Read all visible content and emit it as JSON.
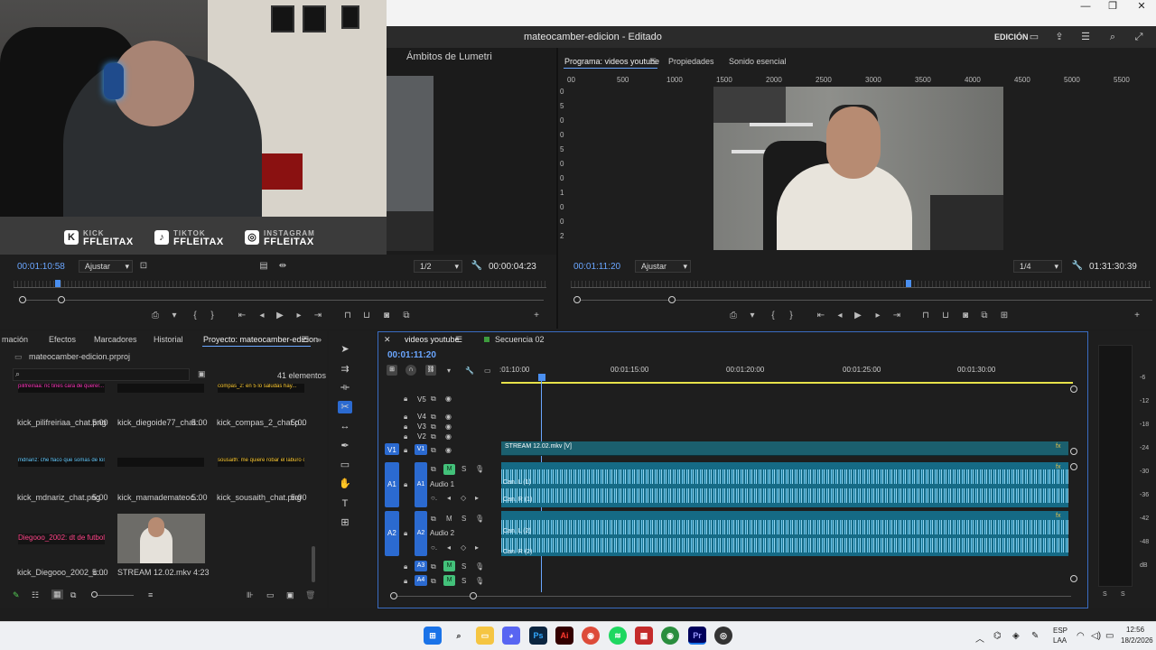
{
  "app": {
    "title": "mateocamber-edicion - Editado",
    "workspace": "EDICIÓN"
  },
  "webcam": {
    "socials": [
      {
        "icon": "kick-icon",
        "small": "KICK",
        "handle": "FFLEITAX",
        "glyph": "K"
      },
      {
        "icon": "tiktok-icon",
        "small": "TIKTOK",
        "handle": "FFLEITAX",
        "glyph": "♪"
      },
      {
        "icon": "instagram-icon",
        "small": "INSTAGRAM",
        "handle": "FFLEITAX",
        "glyph": "◎"
      }
    ]
  },
  "source_panel": {
    "tab": "Ámbitos de Lumetri"
  },
  "source_monitor": {
    "timecode": "00:01:10:58",
    "fit": "Ajustar",
    "resolution": "1/2",
    "duration": "00:00:04:23"
  },
  "program_monitor": {
    "tabs": [
      "Programa: videos youtube",
      "Propiedades",
      "Sonido esencial"
    ],
    "ruler": [
      "00",
      "500",
      "1000",
      "1500",
      "2000",
      "2500",
      "3000",
      "3500",
      "4000",
      "4500",
      "5000",
      "5500"
    ],
    "vruler": [
      "0",
      "5",
      "0",
      "0",
      "5",
      "0",
      "0",
      "1",
      "0",
      "0",
      "2"
    ],
    "timecode": "00:01:11:20",
    "fit": "Ajustar",
    "resolution": "1/4",
    "duration": "01:31:30:39"
  },
  "project": {
    "tabs": [
      "mación",
      "Efectos",
      "Marcadores",
      "Historial",
      "Proyecto: mateocamber-edicion"
    ],
    "file": "mateocamber-edicion.prproj",
    "count": "41 elementos",
    "assets": [
      {
        "name": "kick_pilifreiriaa_chat.png",
        "dur": "5:00",
        "thumb": "pilifreiriaa: nc tines cara de querer..."
      },
      {
        "name": "kick_diegoide77_chat...",
        "dur": "5:00",
        "thumb": ""
      },
      {
        "name": "kick_compas_2_chat.p...",
        "dur": "5:00",
        "thumb": "compas_2: en 5 lo saludas hay..."
      },
      {
        "name": "kick_mdnariz_chat.png",
        "dur": "5:00",
        "thumb": "mdnariz: che flaco que somas de los no"
      },
      {
        "name": "kick_mamademateoc...",
        "dur": "5:00",
        "thumb": ""
      },
      {
        "name": "kick_sousaith_chat.png",
        "dur": "5:00",
        "thumb": "sousaith: me quiere robar el laburo che"
      },
      {
        "name": "kick_Diegooo_2002_c...",
        "dur": "5:00",
        "thumb": "Diegooo_2002: dt de futbol"
      },
      {
        "name": "STREAM 12.02.mkv",
        "dur": "4:23",
        "thumb": ""
      }
    ]
  },
  "timeline": {
    "tabs": [
      "videos youtube",
      "Secuencia 02"
    ],
    "timecode": "00:01:11:20",
    "ruler": [
      ":01:10:00",
      "00:01:15:00",
      "00:01:20:00",
      "00:01:25:00",
      "00:01:30:00"
    ],
    "tracks": {
      "video": [
        "V5",
        "V4",
        "V3",
        "V2",
        "V1"
      ],
      "audio": [
        "A1",
        "A2",
        "A3",
        "A4"
      ],
      "audio_names": [
        "Audio 1",
        "Audio 2"
      ]
    },
    "video_clip": "STREAM 12.02.mkv [V]",
    "channels": [
      "Can. L (1)",
      "Can. R (1)",
      "Can. L (2)",
      "Can. R (2)"
    ]
  },
  "meter": {
    "scale": [
      "-6",
      "-12",
      "-18",
      "-24",
      "-30",
      "-36",
      "-42",
      "-48",
      "dB"
    ],
    "solo": [
      "S",
      "S"
    ]
  },
  "taskbar": {
    "lang": "ESP",
    "lang2": "LAA",
    "time": "12:56",
    "date": "18/2/2026"
  }
}
